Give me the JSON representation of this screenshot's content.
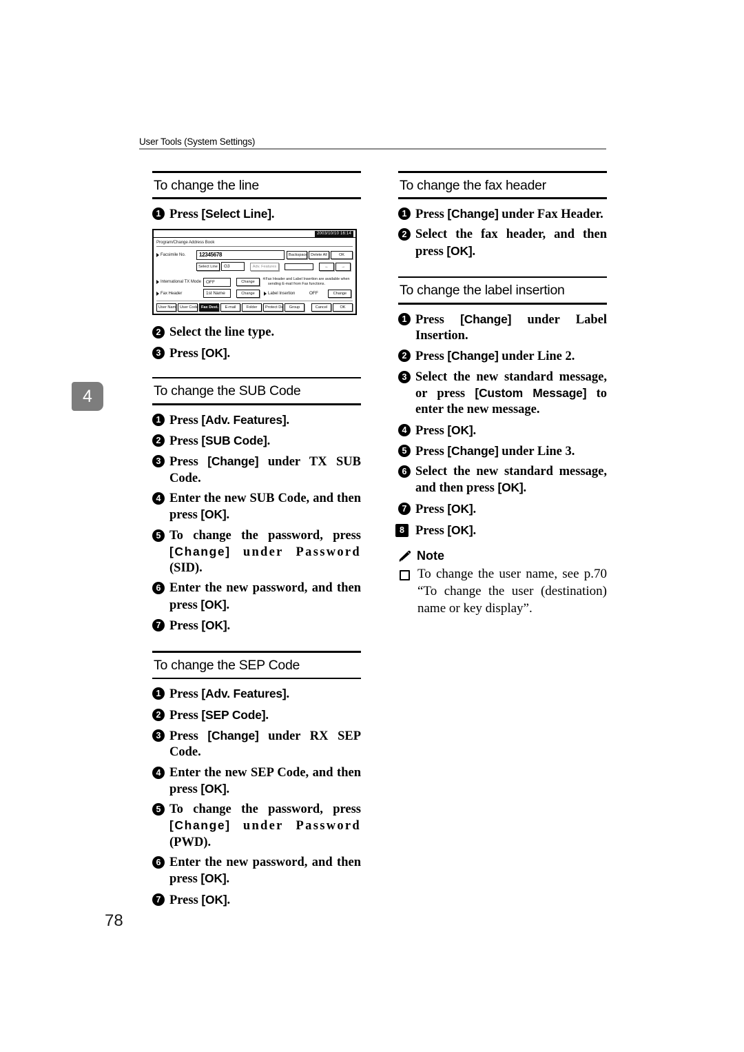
{
  "running_header": "User Tools (System Settings)",
  "chapter_tab": "4",
  "page_number": "78",
  "left_column": {
    "sections": [
      {
        "title": "To change the line",
        "steps_before_figure": [
          {
            "num": "1",
            "parts": [
              {
                "t": "text",
                "v": "Press "
              },
              {
                "t": "key",
                "v": "[Select Line]"
              },
              {
                "t": "text",
                "v": "."
              }
            ]
          }
        ],
        "figure": "lcd-program-change-address-book",
        "steps_after_figure": [
          {
            "num": "2",
            "parts": [
              {
                "t": "text",
                "v": "Select the line type."
              }
            ]
          },
          {
            "num": "3",
            "parts": [
              {
                "t": "text",
                "v": "Press "
              },
              {
                "t": "key",
                "v": "[OK]"
              },
              {
                "t": "text",
                "v": "."
              }
            ]
          }
        ]
      },
      {
        "title": "To change the SUB Code",
        "steps": [
          {
            "num": "1",
            "parts": [
              {
                "t": "text",
                "v": "Press "
              },
              {
                "t": "key",
                "v": "[Adv. Features]"
              },
              {
                "t": "text",
                "v": "."
              }
            ]
          },
          {
            "num": "2",
            "parts": [
              {
                "t": "text",
                "v": "Press "
              },
              {
                "t": "key",
                "v": "[SUB Code]"
              },
              {
                "t": "text",
                "v": "."
              }
            ]
          },
          {
            "num": "3",
            "parts": [
              {
                "t": "text",
                "v": "Press "
              },
              {
                "t": "key",
                "v": "[Change]"
              },
              {
                "t": "text",
                "v": " under TX SUB Code."
              }
            ]
          },
          {
            "num": "4",
            "parts": [
              {
                "t": "text",
                "v": "Enter the new SUB Code, and then press "
              },
              {
                "t": "key",
                "v": "[OK]"
              },
              {
                "t": "text",
                "v": "."
              }
            ]
          },
          {
            "num": "5",
            "parts": [
              {
                "t": "text",
                "v": "To change the password, press "
              },
              {
                "t": "key-tracked",
                "v": "[Change]"
              },
              {
                "t": "tracked",
                "v": " under Password "
              },
              {
                "t": "text",
                "v": "(SID)."
              }
            ]
          },
          {
            "num": "6",
            "parts": [
              {
                "t": "text",
                "v": "Enter the new password, and then press "
              },
              {
                "t": "key",
                "v": "[OK]"
              },
              {
                "t": "text",
                "v": "."
              }
            ]
          },
          {
            "num": "7",
            "parts": [
              {
                "t": "text",
                "v": "Press "
              },
              {
                "t": "key",
                "v": "[OK]"
              },
              {
                "t": "text",
                "v": "."
              }
            ]
          }
        ]
      },
      {
        "title": "To change the SEP Code",
        "steps": [
          {
            "num": "1",
            "parts": [
              {
                "t": "text",
                "v": "Press "
              },
              {
                "t": "key",
                "v": "[Adv. Features]"
              },
              {
                "t": "text",
                "v": "."
              }
            ]
          },
          {
            "num": "2",
            "parts": [
              {
                "t": "text",
                "v": "Press "
              },
              {
                "t": "key",
                "v": "[SEP Code]"
              },
              {
                "t": "text",
                "v": "."
              }
            ]
          },
          {
            "num": "3",
            "parts": [
              {
                "t": "text",
                "v": "Press "
              },
              {
                "t": "key",
                "v": "[Change]"
              },
              {
                "t": "text",
                "v": " under RX SEP Code."
              }
            ]
          },
          {
            "num": "4",
            "parts": [
              {
                "t": "text",
                "v": "Enter the new SEP Code, and then press "
              },
              {
                "t": "key",
                "v": "[OK]"
              },
              {
                "t": "text",
                "v": "."
              }
            ]
          },
          {
            "num": "5",
            "parts": [
              {
                "t": "text",
                "v": "To change the password, press "
              },
              {
                "t": "key-tracked",
                "v": "[Change]"
              },
              {
                "t": "tracked",
                "v": " under Password "
              },
              {
                "t": "text",
                "v": "(PWD)."
              }
            ]
          },
          {
            "num": "6",
            "parts": [
              {
                "t": "text",
                "v": "Enter the new password, and then press "
              },
              {
                "t": "key",
                "v": "[OK]"
              },
              {
                "t": "text",
                "v": "."
              }
            ]
          },
          {
            "num": "7",
            "parts": [
              {
                "t": "text",
                "v": "Press "
              },
              {
                "t": "key",
                "v": "[OK]"
              },
              {
                "t": "text",
                "v": "."
              }
            ]
          }
        ]
      }
    ]
  },
  "right_column": {
    "sections": [
      {
        "title": "To change the fax header",
        "steps": [
          {
            "num": "1",
            "parts": [
              {
                "t": "text",
                "v": "Press "
              },
              {
                "t": "key",
                "v": "[Change]"
              },
              {
                "t": "text",
                "v": " under Fax Header."
              }
            ]
          },
          {
            "num": "2",
            "parts": [
              {
                "t": "text",
                "v": "Select the fax header, and then press "
              },
              {
                "t": "key",
                "v": "[OK]"
              },
              {
                "t": "text",
                "v": "."
              }
            ]
          }
        ]
      },
      {
        "title": "To change the label insertion",
        "steps": [
          {
            "num": "1",
            "parts": [
              {
                "t": "text",
                "v": "Press "
              },
              {
                "t": "key",
                "v": "[Change]"
              },
              {
                "t": "text",
                "v": " under Label Insertion."
              }
            ]
          },
          {
            "num": "2",
            "parts": [
              {
                "t": "text",
                "v": "Press "
              },
              {
                "t": "key",
                "v": "[Change]"
              },
              {
                "t": "text",
                "v": " under Line 2."
              }
            ]
          },
          {
            "num": "3",
            "parts": [
              {
                "t": "text",
                "v": "Select the new standard message, or press "
              },
              {
                "t": "key",
                "v": "[Custom Message]"
              },
              {
                "t": "text",
                "v": " to enter the new message."
              }
            ]
          },
          {
            "num": "4",
            "parts": [
              {
                "t": "text",
                "v": "Press "
              },
              {
                "t": "key",
                "v": "[OK]"
              },
              {
                "t": "text",
                "v": "."
              }
            ]
          },
          {
            "num": "5",
            "parts": [
              {
                "t": "text",
                "v": "Press "
              },
              {
                "t": "key",
                "v": "[Change]"
              },
              {
                "t": "text",
                "v": " under Line 3."
              }
            ]
          },
          {
            "num": "6",
            "parts": [
              {
                "t": "text",
                "v": "Select the new standard message, and then press "
              },
              {
                "t": "key",
                "v": "[OK]"
              },
              {
                "t": "text",
                "v": "."
              }
            ]
          },
          {
            "num": "7",
            "parts": [
              {
                "t": "text",
                "v": "Press "
              },
              {
                "t": "key",
                "v": "[OK]"
              },
              {
                "t": "text",
                "v": "."
              }
            ]
          }
        ],
        "final_step": {
          "num": "8",
          "parts": [
            {
              "t": "text",
              "v": "Press "
            },
            {
              "t": "key",
              "v": "[OK]"
            },
            {
              "t": "text",
              "v": "."
            }
          ]
        }
      }
    ],
    "note": {
      "label": "Note",
      "items": [
        "To change the user name, see p.70 “To change the user (destination) name or key display”."
      ]
    }
  },
  "figure_lcd": {
    "clock": "2003/10/10     16:14",
    "window_title": "Program/Change Address Book",
    "facsimile_label": "Facsimile No.",
    "facsimile_value": "12345678",
    "top_buttons": [
      "Backspace",
      "Delete All",
      "OK"
    ],
    "second_row": {
      "select_line": "Select Line",
      "line_value": "G3",
      "adv_features": "Adv. Features",
      "blank_field": "",
      "pause_btn": "←",
      "tone_btn": "→"
    },
    "intl_tx_label": "International TX Mode",
    "intl_tx_value": "OFF",
    "intl_tx_button": "Change",
    "hint_line1": "※Fax Header and Label Insertion are available when",
    "hint_line2": "sending E-mail from Fax functions.",
    "fax_header_label": "Fax Header",
    "fax_header_value": "1st Name",
    "fax_header_button": "Change",
    "label_insertion_label": "Label Insertion",
    "label_insertion_value": "OFF",
    "label_insertion_button": "Change",
    "tabs": [
      "User Name",
      "User Code",
      "Fax Dest.",
      "E-mail",
      "Folder",
      "Protect Dest.",
      "Group"
    ],
    "selected_tab": "Fax Dest.",
    "action_buttons": [
      "Cancel",
      "OK"
    ]
  }
}
